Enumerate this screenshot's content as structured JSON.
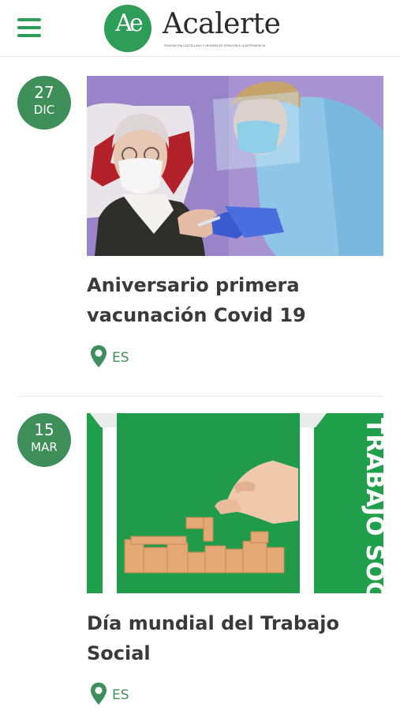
{
  "header": {
    "logo_monogram": "Ae",
    "logo_name": "Acalerte",
    "logo_tagline": "FEDERACIÓN CASTELLANO Y LEONESA DE ATENCIÓN A LA DEPENDENCIA",
    "menu_icon": "hamburger-menu-icon"
  },
  "posts": [
    {
      "day": "27",
      "month": "DIC",
      "title": "Aniversario primera vacunación Covid 19",
      "location": "ES",
      "image": "elderly-woman-vaccination-photo"
    },
    {
      "day": "15",
      "month": "MAR",
      "title": "Día mundial del Trabajo Social",
      "location": "ES",
      "image": "wooden-puzzle-hand-trabajo-social",
      "image_caption": "TRABAJO SOCIAL"
    }
  ],
  "colors": {
    "brand_green": "#2e9d57",
    "badge_green": "#3f8f5b",
    "image_green": "#21a04b"
  }
}
